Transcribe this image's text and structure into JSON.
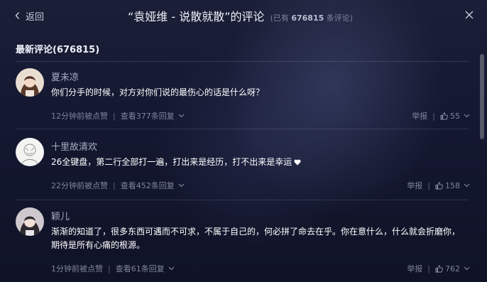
{
  "header": {
    "back_label": "返回",
    "title": "“袁娅维 - 说散就散”的评论",
    "count_prefix": "(已有 ",
    "count_value": "676815",
    "count_suffix": " 条评论)"
  },
  "section": {
    "title": "最新评论(676815)"
  },
  "comments": [
    {
      "user": "夏未凉",
      "text": "你们分手的时候，对方对你们说的最伤心的话是什么呀？",
      "time": "12分钟前被点赞",
      "replies": "查看377条回复",
      "report": "举报",
      "likes": "55"
    },
    {
      "user": "十里故清欢",
      "text": "26全键盘，第二行全部打一遍，打出来是经历，打不出来是幸运",
      "time": "22分钟前被点赞",
      "replies": "查看452条回复",
      "report": "举报",
      "likes": "158"
    },
    {
      "user": "颖儿",
      "text": "渐渐的知道了，很多东西可遇而不可求，不属于自己的，何必拼了命去在乎。你在意什么，什么就会折磨你，期待是所有心痛的根源。",
      "time": "1分钟前被点赞",
      "replies": "查看61条回复",
      "report": "举报",
      "likes": "762"
    }
  ],
  "separator": "|",
  "colors": {
    "background": "#141831",
    "text": "#ffffff",
    "muted": "#7f849c",
    "username": "#a9aec6"
  },
  "icons": [
    "chevron-left-icon",
    "close-icon",
    "chevron-down-icon",
    "thumbs-up-icon",
    "heart-icon"
  ]
}
